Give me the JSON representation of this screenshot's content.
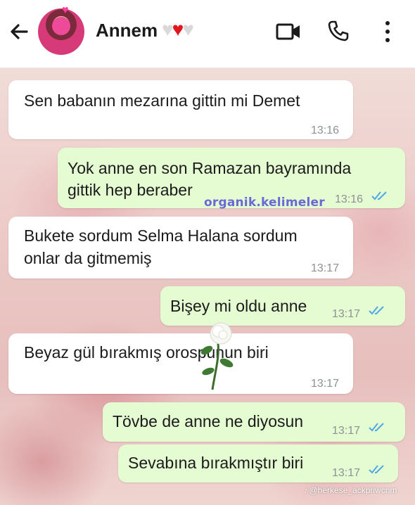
{
  "header": {
    "contact_name": "Annem",
    "name_emojis": [
      "white-heart",
      "red-heart",
      "white-heart"
    ]
  },
  "messages": [
    {
      "direction": "incoming",
      "text": "Sen babanın mezarına gittin mi Demet",
      "time": "13:16"
    },
    {
      "direction": "outgoing",
      "lines": [
        "Yok anne en son Ramazan bayramında",
        "gittik hep beraber"
      ],
      "time": "13:16",
      "status": "read"
    },
    {
      "direction": "incoming",
      "lines": [
        "Bukete sordum Selma Halana sordum",
        "onlar da gitmemiş"
      ],
      "time": "13:17"
    },
    {
      "direction": "outgoing",
      "text": "Bişey mi oldu anne",
      "time": "13:17",
      "status": "read"
    },
    {
      "direction": "incoming",
      "text": "Beyaz gül bırakmış orospunun biri",
      "time": "13:17"
    },
    {
      "direction": "outgoing",
      "text": "Tövbe de anne ne diyosun",
      "time": "13:17",
      "status": "read"
    },
    {
      "direction": "outgoing",
      "text": "Sevabına bırakmıştır biri",
      "time": "13:17",
      "status": "read"
    }
  ],
  "overlays": {
    "watermark_text": "organik.kelimeler",
    "tiktok_handle": "@herkese_ackpriwcnm",
    "sticker": "white-rose"
  },
  "colors": {
    "incoming_bubble": "#ffffff",
    "outgoing_bubble": "#e5fbd2",
    "read_ticks": "#4fa9e6",
    "watermark": "#6a68d6"
  }
}
